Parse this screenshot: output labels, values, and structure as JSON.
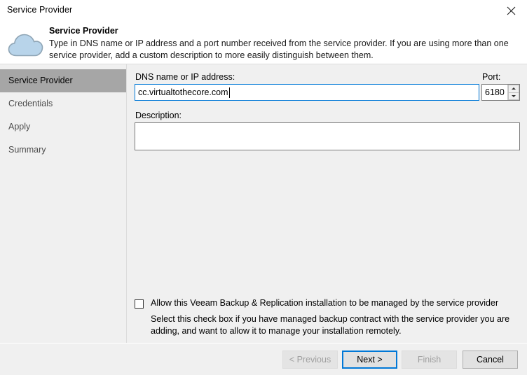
{
  "window": {
    "title": "Service Provider",
    "close_icon": "close-icon"
  },
  "header": {
    "icon": "cloud-icon",
    "title": "Service Provider",
    "description": "Type in DNS name or IP address and a port number received from the service provider. If you are using more than one service provider, add a custom description to more easily distinguish between them."
  },
  "sidebar": {
    "items": [
      {
        "label": "Service Provider",
        "selected": true
      },
      {
        "label": "Credentials",
        "selected": false
      },
      {
        "label": "Apply",
        "selected": false
      },
      {
        "label": "Summary",
        "selected": false
      }
    ]
  },
  "form": {
    "dns": {
      "label": "DNS name or IP address:",
      "value": "cc.virtualtothecore.com",
      "placeholder": ""
    },
    "port": {
      "label": "Port:",
      "value": "6180",
      "spin_up_icon": "arrow-up-icon",
      "spin_down_icon": "arrow-down-icon"
    },
    "description": {
      "label": "Description:",
      "value": "",
      "placeholder": ""
    },
    "managed_checkbox": {
      "label": "Allow this Veeam Backup & Replication installation to be managed by the service provider",
      "checked": false,
      "help_text": "Select this check box if you have managed backup contract with the service provider you are adding, and want to allow it to manage your installation remotely."
    }
  },
  "footer": {
    "previous_label": "< Previous",
    "next_label": "Next >",
    "finish_label": "Finish",
    "cancel_label": "Cancel"
  },
  "colors": {
    "accent": "#0078d7",
    "selection": "#a6a6a6",
    "dialog_bg": "#f0f0f0",
    "cloud_fill": "#b8d4ea",
    "cloud_stroke": "#8fa5b5"
  }
}
